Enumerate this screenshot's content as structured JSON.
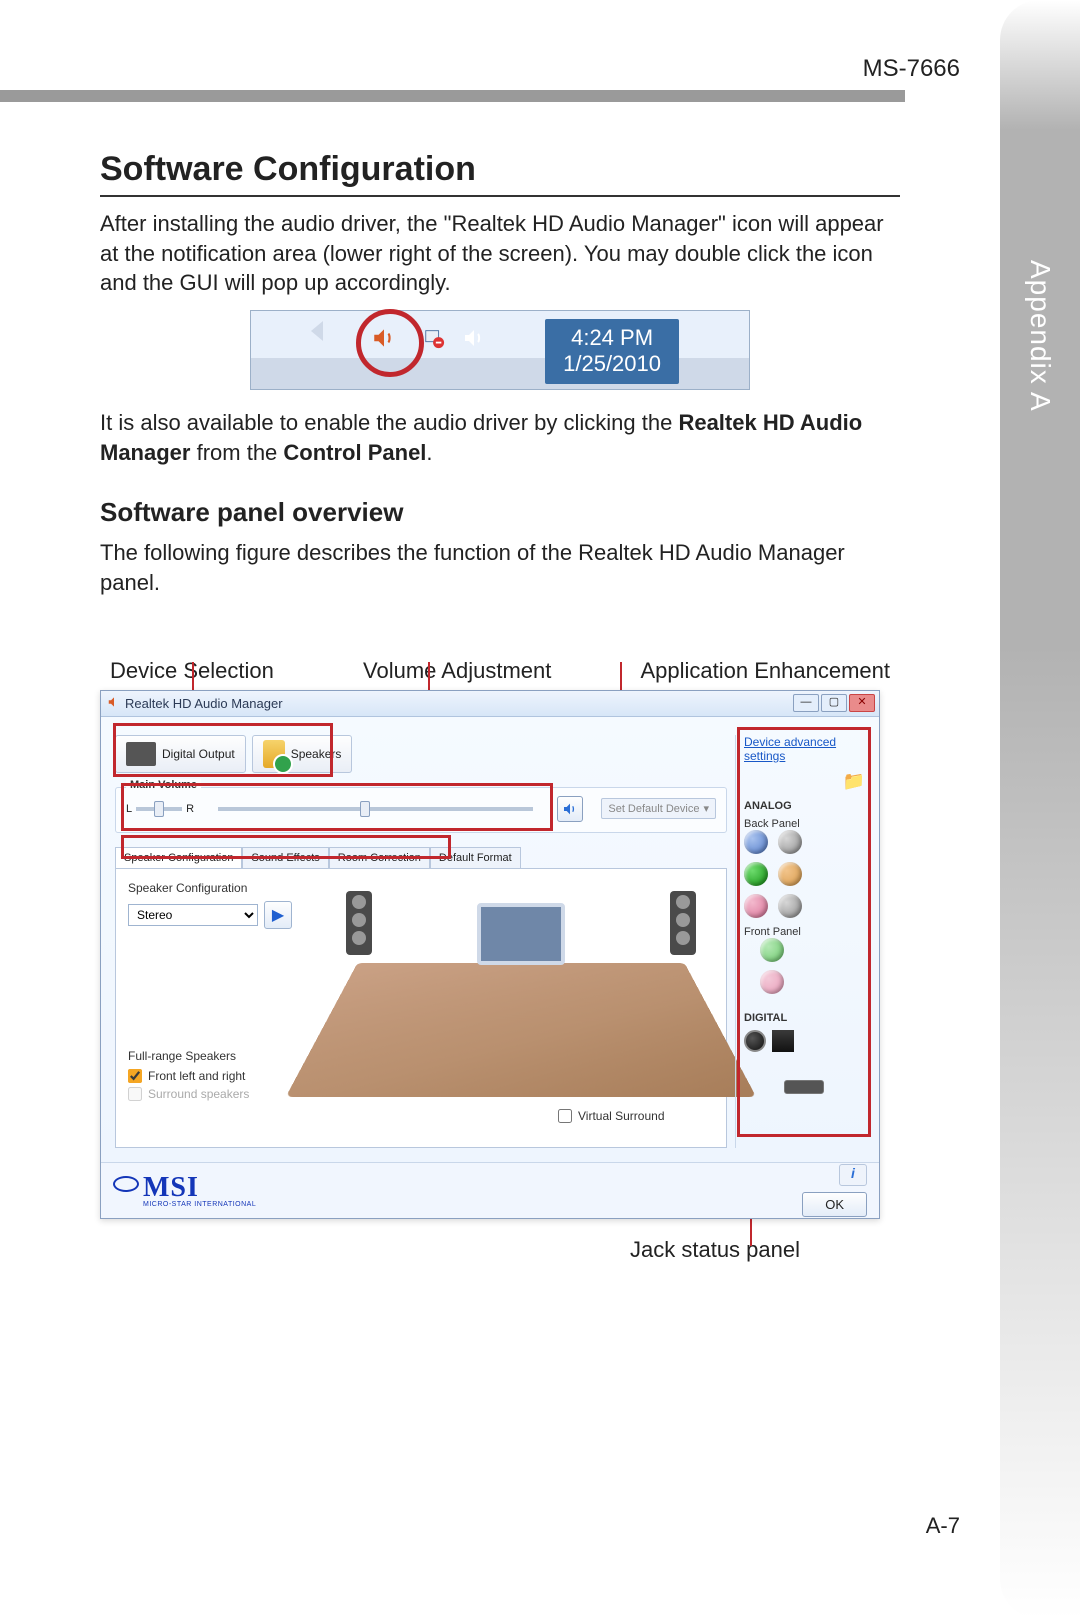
{
  "doc": {
    "model": "MS-7666",
    "sideTab": "Appendix A",
    "pageNo": "A-7"
  },
  "section": {
    "title": "Software Configuration",
    "para1a": "After installing the audio driver, the \"Realtek HD Audio Manager\" icon will appear at the notification area (lower right of the screen). You may double click the icon and the GUI will pop up accordingly.",
    "para2a": "It is also available to enable the audio driver by clicking the ",
    "para2b": "Realtek HD Audio Manager",
    "para2c": " from the ",
    "para2d": "Control Panel",
    "para2e": ".",
    "sub1": "Software panel overview",
    "para3": "The following figure describes the function of the Realtek HD Audio Manager panel."
  },
  "tray": {
    "time": "4:24 PM",
    "date": "1/25/2010"
  },
  "anno": {
    "dev": "Device Selection",
    "vol": "Volume Adjustment",
    "app": "Application Enhancement",
    "jack": "Jack status panel"
  },
  "rt": {
    "title": "Realtek HD Audio Manager",
    "devDigital": "Digital Output",
    "devSpeakers": "Speakers",
    "mainVolume": "Main Volume",
    "L": "L",
    "R": "R",
    "setDefault": "Set Default Device",
    "tabs": {
      "t1": "Speaker Configuration",
      "t2": "Sound Effects",
      "t3": "Room Correction",
      "t4": "Default Format"
    },
    "spkConfLabel": "Speaker Configuration",
    "spkSelect": "Stereo",
    "frTitle": "Full-range Speakers",
    "frFront": "Front left and right",
    "frSurr": "Surround speakers",
    "virtSurr": "Virtual Surround",
    "advLink": "Device advanced settings",
    "analog": "ANALOG",
    "backPanel": "Back Panel",
    "frontPanel": "Front Panel",
    "digital": "DIGITAL",
    "ok": "OK",
    "msi": "MSI",
    "msiSub": "MICRO-STAR INTERNATIONAL"
  }
}
